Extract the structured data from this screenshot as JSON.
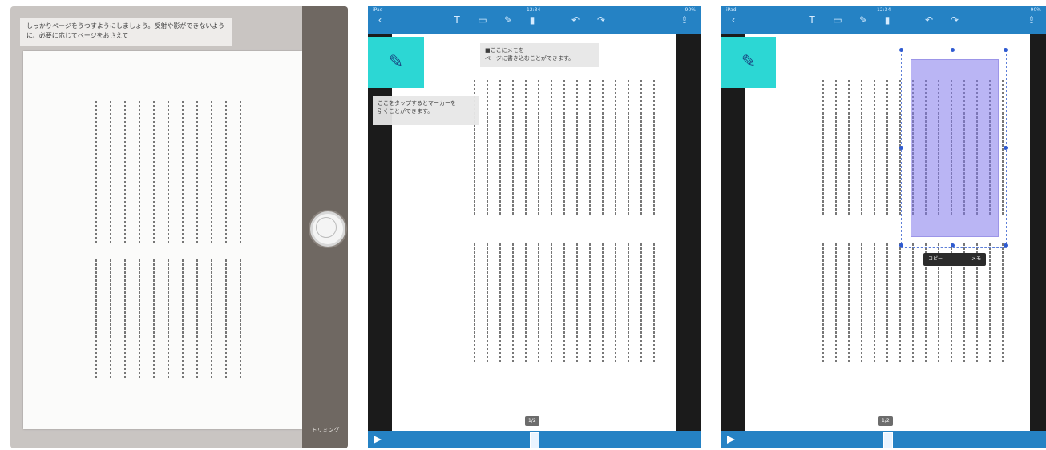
{
  "camera_panel": {
    "tip_text": "しっかりページをうつすようにしましょう。反射や影ができないように、必要に応じてページをおさえて",
    "shutter_label": "撮影",
    "mode_label": "トリミング"
  },
  "reader_panels": [
    {
      "status_left": "iPad",
      "status_center": "12:34",
      "status_right": "90%",
      "tooltip_top": "■ここにメモを\nページに書き込むことができます。",
      "tooltip_left": "ここをタップするとマーカーを\n引くことができます。",
      "page_number": "1/2"
    },
    {
      "status_left": "iPad",
      "status_center": "12:34",
      "status_right": "90%",
      "menu_left": "コピー",
      "menu_right": "メモ",
      "page_number": "1/2"
    }
  ],
  "icons": {
    "toolbar": [
      "text-tool-icon",
      "photo-tool-icon",
      "pen-tool-icon",
      "marker-tool-icon",
      "undo-icon",
      "redo-icon",
      "share-icon"
    ],
    "pen_glyph": "✎",
    "text_glyph": "T"
  },
  "colors": {
    "accent": "#2582c4",
    "highlight": "#2cd7d4",
    "selection": "#8f88ea"
  }
}
